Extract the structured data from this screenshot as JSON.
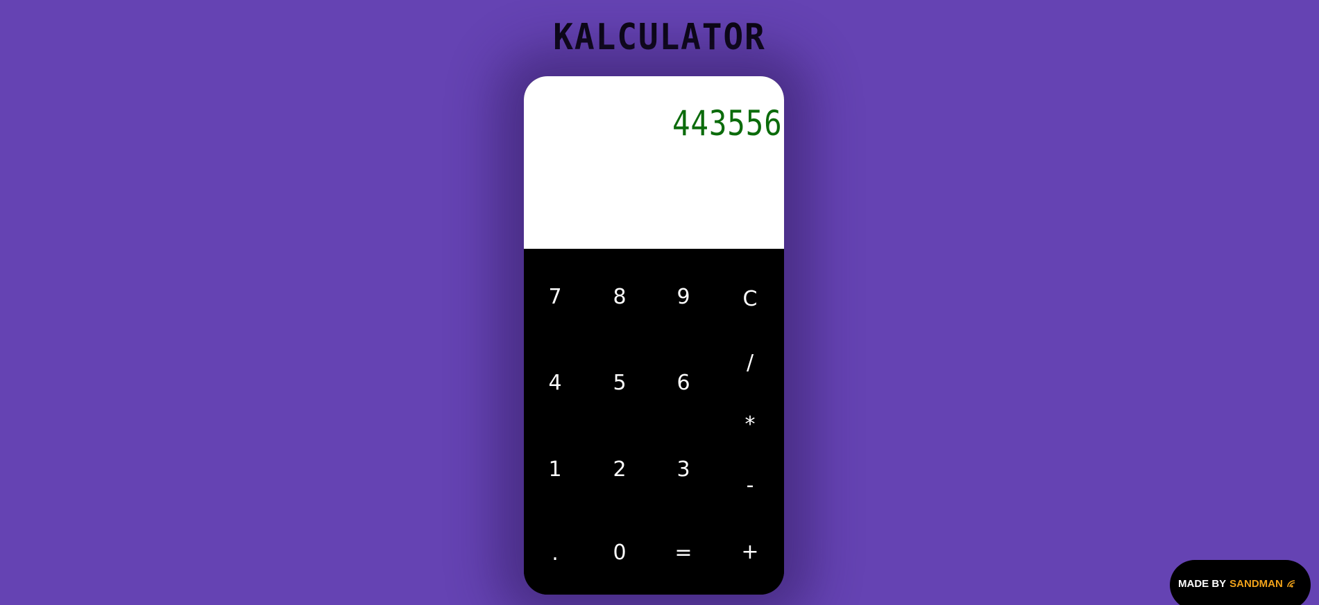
{
  "app": {
    "title": "KALCULATOR"
  },
  "display": {
    "value": "443556"
  },
  "keypad": {
    "keys": {
      "seven": "7",
      "eight": "8",
      "nine": "9",
      "clear": "C",
      "four": "4",
      "five": "5",
      "six": "6",
      "divide": "/",
      "multiply": "*",
      "one": "1",
      "two": "2",
      "three": "3",
      "subtract": "-",
      "decimal": ".",
      "zero": "0",
      "equals": "=",
      "add": "+"
    }
  },
  "credit": {
    "prefix": "MADE BY",
    "author": "SANDMAN",
    "icon": "wave-icon"
  },
  "colors": {
    "background": "#6543b3",
    "display_text": "#0b6b0b",
    "credit_accent": "#f0a21a"
  }
}
